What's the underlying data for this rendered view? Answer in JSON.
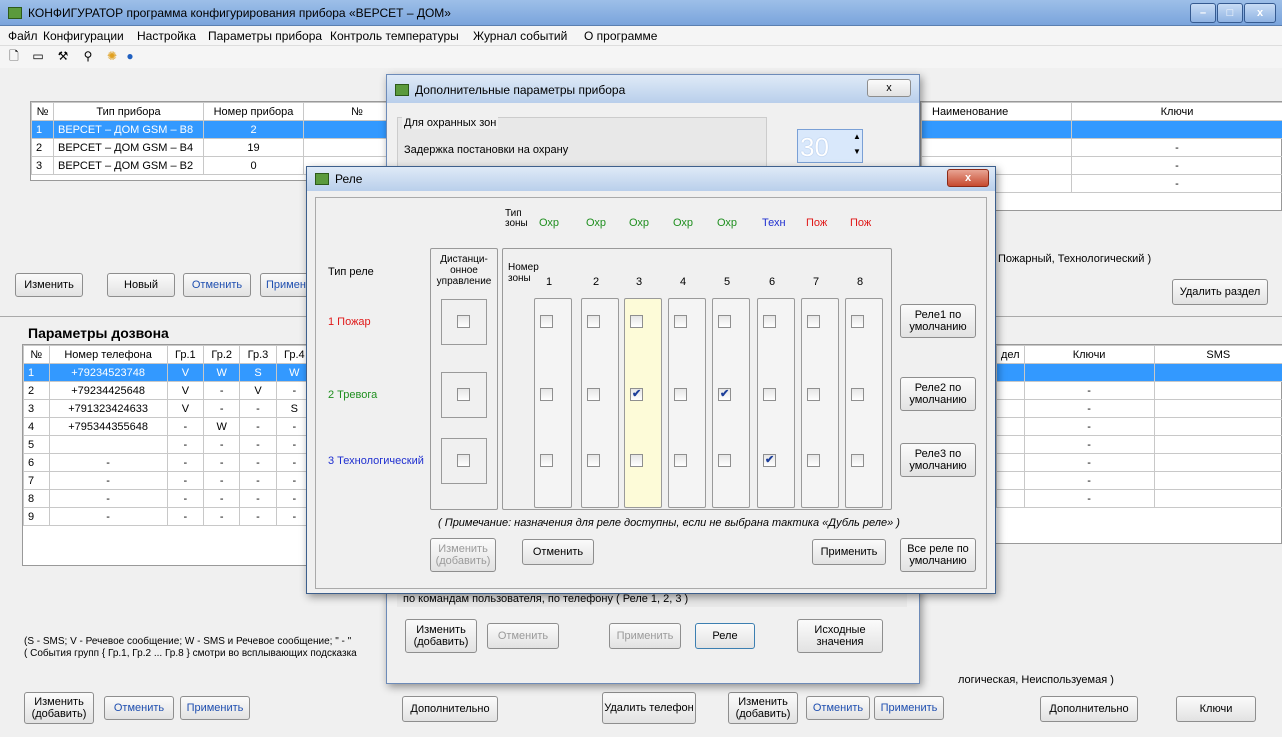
{
  "main_window": {
    "title": "КОНФИГУРАТОР программа конфигурирования прибора «ВЕРСЕТ – ДОМ»",
    "min": "–",
    "max": "□",
    "close": "x"
  },
  "menu": [
    "Файл",
    "Конфигурации",
    "Настройка",
    "Параметры прибора",
    "Контроль температуры",
    "Журнал событий",
    "О программе"
  ],
  "devices": {
    "headers": [
      "№",
      "Тип прибора",
      "Номер прибора",
      "№"
    ],
    "rows": [
      [
        "1",
        "ВЕРСЕТ – ДОМ GSM – B8",
        "2"
      ],
      [
        "2",
        "ВЕРСЕТ – ДОМ GSM – B4",
        "19"
      ],
      [
        "3",
        "ВЕРСЕТ – ДОМ GSM – B2",
        "0"
      ]
    ],
    "buttons": {
      "edit": "Изменить",
      "new": "Новый",
      "cancel": "Отменить",
      "apply": "Применить"
    }
  },
  "right_top": {
    "headers": [
      "Наименование",
      "Ключи"
    ],
    "rows": [
      [
        "",
        ""
      ],
      [
        "",
        "-"
      ],
      [
        "",
        "-"
      ],
      [
        "",
        "-"
      ]
    ],
    "note": "Пожарный, Технологический )",
    "delete": "Удалить раздел"
  },
  "dial": {
    "title": "Параметры дозвона",
    "headers": [
      "№",
      "Номер телефона",
      "Гр.1",
      "Гр.2",
      "Гр.3",
      "Гр.4"
    ],
    "rows": [
      [
        "1",
        "+79234523748",
        "V",
        "W",
        "S",
        "W"
      ],
      [
        "2",
        "+79234425648",
        "V",
        "-",
        "V",
        "-"
      ],
      [
        "3",
        "+791323424633",
        "V",
        "-",
        "-",
        "S"
      ],
      [
        "4",
        "+795344355648",
        "-",
        "W",
        "-",
        "-"
      ],
      [
        "5",
        "",
        "-",
        "-",
        "-",
        "-"
      ],
      [
        "6",
        "-",
        "-",
        "-",
        "-",
        "-"
      ],
      [
        "7",
        "-",
        "-",
        "-",
        "-",
        "-"
      ],
      [
        "8",
        "-",
        "-",
        "-",
        "-",
        "-"
      ],
      [
        "9",
        "-",
        "-",
        "-",
        "-",
        "-"
      ]
    ],
    "legend1": "(S - SMS;  V - Речевое сообщение;  W - SMS и Речевое сообщение; \" - \"",
    "legend2": "( События групп { Гр.1, Гр.2 ... Гр.8 } смотри во всплывающих подсказка",
    "btn_edit": "Изменить (добавить)",
    "btn_cancel": "Отменить",
    "btn_apply": "Применить",
    "btn_extra": "Дополнительно",
    "btn_delete": "Удалить телефон"
  },
  "right_bottom": {
    "headers": [
      "дел",
      "Ключи",
      "SMS"
    ],
    "rows": [
      [
        "",
        ""
      ],
      [
        "",
        "-"
      ],
      [
        "",
        "-"
      ],
      [
        "",
        "-"
      ],
      [
        "",
        "-"
      ],
      [
        "",
        "-"
      ],
      [
        "",
        "-"
      ],
      [
        "",
        "-"
      ]
    ],
    "note": "логическая, Неиспользуемая )",
    "btn_edit": "Изменить (добавить)",
    "btn_cancel": "Отменить",
    "btn_apply": "Применить",
    "btn_extra": "Дополнительно",
    "btn_keys": "Ключи"
  },
  "extra_dialog": {
    "title": "Дополнительные параметры прибора",
    "close": "x",
    "group": "Для охранных зон",
    "delay_label": "Задержка постановки на охрану",
    "delay_value": "30",
    "relay_text": "по командам пользователя, по телефону  ( Реле 1, 2, 3 )",
    "btn_edit": "Изменить (добавить)",
    "btn_cancel": "Отменить",
    "btn_apply": "Применить",
    "btn_relay": "Реле",
    "btn_defaults": "Исходные значения"
  },
  "relay_dialog": {
    "title": "Реле",
    "close": "x",
    "zone_type_label": "Тип зоны",
    "relay_type_label": "Тип реле",
    "remote_label": "Дистанци- онное управление",
    "zone_number_label": "Номер зоны",
    "zone_types": [
      "Охр",
      "Охр",
      "Охр",
      "Охр",
      "Охр",
      "Техн",
      "Пож",
      "Пож"
    ],
    "zone_numbers": [
      "1",
      "2",
      "3",
      "4",
      "5",
      "6",
      "7",
      "8"
    ],
    "relays": [
      "1 Пожар",
      "2 Тревога",
      "3 Технологический"
    ],
    "relay_defaults": [
      "Реле1 по умолчанию",
      "Реле2 по умолчанию",
      "Реле3 по умолчанию"
    ],
    "checks": [
      [
        false,
        false,
        false,
        false,
        false,
        false,
        false,
        false
      ],
      [
        false,
        false,
        true,
        false,
        true,
        false,
        false,
        false
      ],
      [
        false,
        false,
        false,
        false,
        false,
        true,
        false,
        false
      ]
    ],
    "remote": [
      false,
      false,
      false
    ],
    "note": "( Примечание: назначения для реле доступны, если не выбрана тактика «Дубль реле» )",
    "btn_edit": "Изменить (добавить)",
    "btn_cancel": "Отменить",
    "btn_apply": "Применить",
    "btn_all_defaults": "Все реле по умолчанию",
    "colors": {
      "guard": "#1f8f1f",
      "tech": "#1f2fd0",
      "fire": "#e01818"
    }
  }
}
